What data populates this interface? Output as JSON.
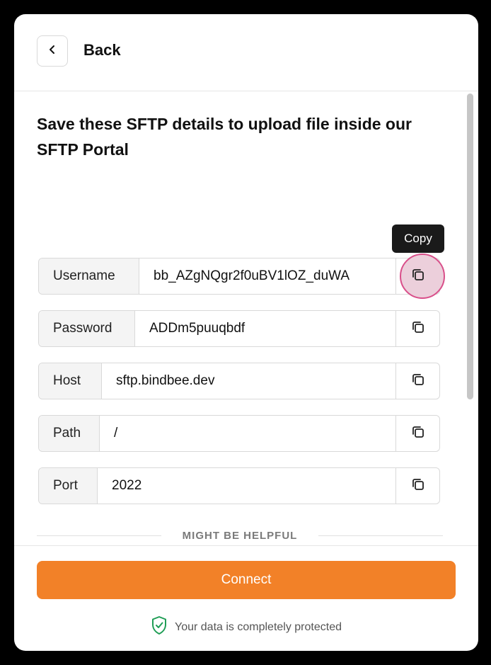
{
  "header": {
    "back_label": "Back"
  },
  "title": "Save these SFTP details to upload file inside our SFTP Portal",
  "fields": [
    {
      "label": "Username",
      "value": "bb_AZgNQgr2f0uBV1lOZ_duWA"
    },
    {
      "label": "Password",
      "value": "ADDm5puuqbdf"
    },
    {
      "label": "Host",
      "value": "sftp.bindbee.dev"
    },
    {
      "label": "Path",
      "value": "/"
    },
    {
      "label": "Port",
      "value": "2022"
    }
  ],
  "tooltip": "Copy",
  "divider": "MIGHT BE HELPFUL",
  "connect_label": "Connect",
  "protect_text": "Your data is completely protected",
  "colors": {
    "accent": "#f28128",
    "shield": "#1f9d55",
    "hover_halo": "#eccfdb",
    "hover_ring": "#d94f8a"
  }
}
